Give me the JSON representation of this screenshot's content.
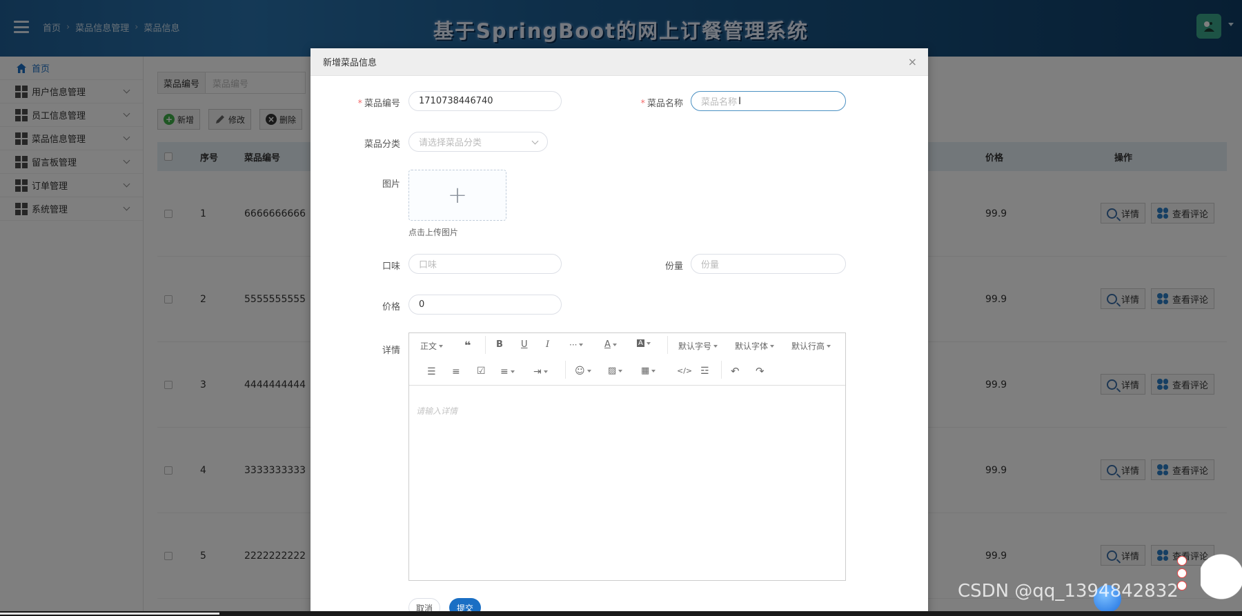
{
  "header": {
    "breadcrumbs": [
      "首页",
      "菜品信息管理",
      "菜品信息"
    ],
    "title": "基于SpringBoot的网上订餐管理系统"
  },
  "sidebar": {
    "items": [
      {
        "label": "首页"
      },
      {
        "label": "用户信息管理"
      },
      {
        "label": "员工信息管理"
      },
      {
        "label": "菜品信息管理"
      },
      {
        "label": "留言板管理"
      },
      {
        "label": "订单管理"
      },
      {
        "label": "系统管理"
      }
    ]
  },
  "main": {
    "search_label": "菜品编号",
    "search_placeholder": "菜品编号",
    "toolbar": {
      "add": "新增",
      "edit": "修改",
      "delete": "删除"
    },
    "columns": {
      "index": "序号",
      "code": "菜品编号",
      "price": "价格",
      "ops": "操作"
    },
    "rows": [
      {
        "index": "1",
        "code": "6666666666",
        "price": "99.9"
      },
      {
        "index": "2",
        "code": "5555555555",
        "price": "99.9"
      },
      {
        "index": "3",
        "code": "4444444444",
        "price": "99.9"
      },
      {
        "index": "4",
        "code": "3333333333",
        "price": "99.9"
      },
      {
        "index": "5",
        "code": "2222222222",
        "price": "99.9"
      }
    ],
    "row_actions": {
      "detail": "详情",
      "comments": "查看评论"
    }
  },
  "modal": {
    "title": "新增菜品信息",
    "close": "×",
    "fields": {
      "code": {
        "label": "菜品编号",
        "value": "1710738446740"
      },
      "name": {
        "label": "菜品名称",
        "placeholder": "菜品名称"
      },
      "category": {
        "label": "菜品分类",
        "placeholder": "请选择菜品分类"
      },
      "image": {
        "label": "图片",
        "tip": "点击上传图片"
      },
      "taste": {
        "label": "口味",
        "placeholder": "口味"
      },
      "portion": {
        "label": "份量",
        "placeholder": "份量"
      },
      "price": {
        "label": "价格",
        "value": "0"
      },
      "detail": {
        "label": "详情",
        "placeholder": "请输入详情"
      }
    },
    "editor": {
      "paragraph": "正文",
      "font_size": "默认字号",
      "font_family": "默认字体",
      "line_height": "默认行高"
    },
    "cancel": "取消",
    "submit": "提交"
  },
  "watermark": "CSDN @qq_1394842832",
  "colors": {
    "header": "#1f5f96",
    "primary": "#1a6fc4",
    "required": "#f56c6c"
  }
}
